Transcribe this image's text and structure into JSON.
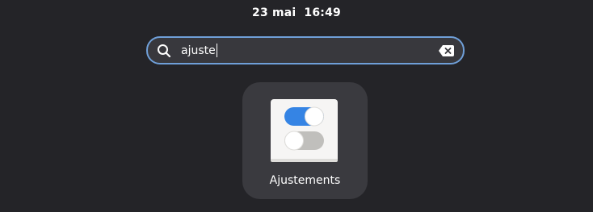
{
  "top_bar": {
    "date": "23 mai",
    "time": "16:49"
  },
  "search": {
    "value": "ajuste",
    "icon": "search-icon",
    "clear_icon": "clear-text-icon",
    "border_color": "#6f9fd8"
  },
  "results": [
    {
      "label": "Ajustements",
      "icon": "toggle-switches-icon",
      "selected": true
    }
  ],
  "colors": {
    "background": "#242428",
    "tile": "#3a3a3f",
    "toggle_on": "#3584e4",
    "toggle_off": "#c0bfbc",
    "icon_bg": "#f6f5f4"
  }
}
